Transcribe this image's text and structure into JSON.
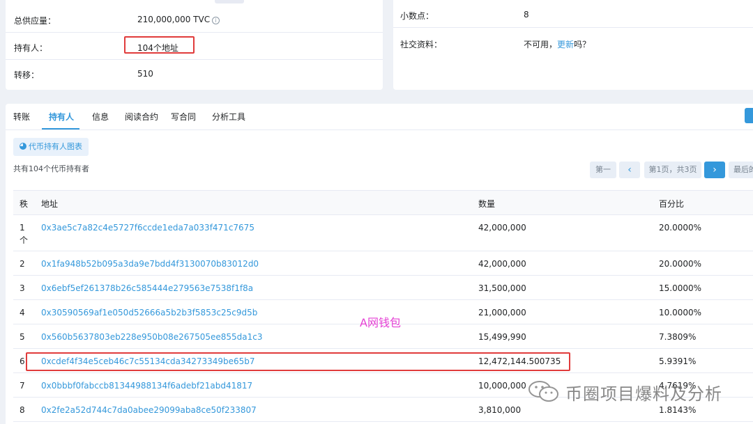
{
  "overview": {
    "total_supply_label": "总供应量：",
    "total_supply_value": "210,000,000 TVC",
    "holders_label": "持有人：",
    "holders_value": "104个地址",
    "transfers_label": "转移：",
    "transfers_value": "510"
  },
  "profile": {
    "decimals_label": "小数点：",
    "decimals_value": "8",
    "social_label": "社交资料：",
    "social_prefix": "不可用，",
    "social_link": "更新",
    "social_suffix": "吗？"
  },
  "tabs": [
    "转账",
    "持有人",
    "信息",
    "阅读合约",
    "写合同",
    "分析工具"
  ],
  "holders_panel": {
    "chart_button": "代币持有人图表",
    "summary": "共有104个代币持有者",
    "pager": {
      "first": "第一",
      "prev": "‹",
      "page": "第1页，共3页",
      "next": "›",
      "last": "最后的"
    }
  },
  "table": {
    "headers": {
      "rank": "秩",
      "address": "地址",
      "quantity": "数量",
      "percentage": "百分比"
    },
    "rows": [
      {
        "rank": "1",
        "rank_suffix": "个",
        "address": "0x3ae5c7a82c4e5727f6ccde1eda7a033f471c7675",
        "quantity": "42,000,000",
        "percentage": "20.0000%"
      },
      {
        "rank": "2",
        "address": "0x1fa948b52b095a3da9e7bdd4f3130070b83012d0",
        "quantity": "42,000,000",
        "percentage": "20.0000%"
      },
      {
        "rank": "3",
        "address": "0x6ebf5ef261378b26c585444e279563e7538f1f8a",
        "quantity": "31,500,000",
        "percentage": "15.0000%"
      },
      {
        "rank": "4",
        "address": "0x30590569af1e050d52666a5b2b3f5853c25c9d5b",
        "quantity": "21,000,000",
        "percentage": "10.0000%"
      },
      {
        "rank": "5",
        "address": "0x560b5637803eb228e950b08e267505ee855da1c3",
        "quantity": "15,499,990",
        "percentage": "7.3809%"
      },
      {
        "rank": "6",
        "address": "0xcdef4f34e5ceb46c7c55134cda34273349be65b7",
        "quantity": "12,472,144.500735",
        "percentage": "5.9391%"
      },
      {
        "rank": "7",
        "address": "0x0bbbf0fabccb81344988134f6adebf21abd41817",
        "quantity": "10,000,000",
        "percentage": "4.7619%"
      },
      {
        "rank": "8",
        "address": "0x2fe2a52d744c7da0abee29099aba8ce50f233807",
        "quantity": "3,810,000",
        "percentage": "1.8143%"
      }
    ]
  },
  "annotation": "A网钱包",
  "watermark": "币圈项目爆料及分析",
  "colors": {
    "link": "#3498db",
    "highlight": "#e03b3b",
    "annotation": "#e43fd4"
  }
}
